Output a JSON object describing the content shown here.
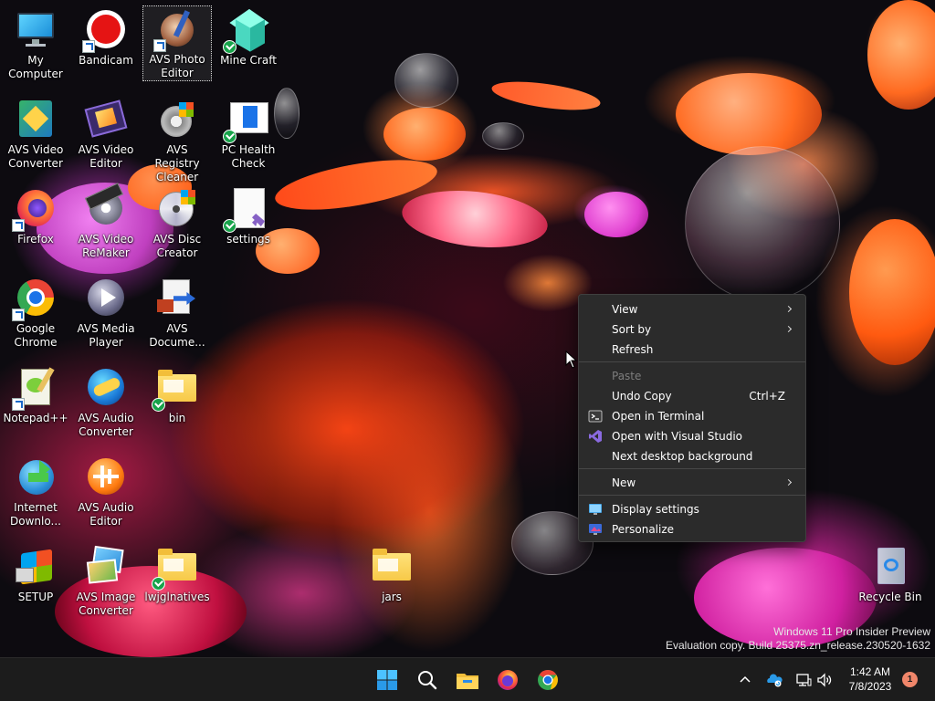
{
  "desktop": {
    "icons": [
      {
        "label": "My Computer"
      },
      {
        "label": "Bandicam"
      },
      {
        "label": "AVS Photo Editor"
      },
      {
        "label": "Mine Craft"
      },
      {
        "label": "AVS Video Converter"
      },
      {
        "label": "AVS Video Editor"
      },
      {
        "label": "AVS Registry Cleaner"
      },
      {
        "label": "PC Health Check"
      },
      {
        "label": "Firefox"
      },
      {
        "label": "AVS Video ReMaker"
      },
      {
        "label": "AVS Disc Creator"
      },
      {
        "label": "settings"
      },
      {
        "label": "Google Chrome"
      },
      {
        "label": "AVS Media Player"
      },
      {
        "label": "AVS Docume..."
      },
      {
        "label": "Notepad++"
      },
      {
        "label": "AVS Audio Converter"
      },
      {
        "label": "bin"
      },
      {
        "label": "Internet Downlo..."
      },
      {
        "label": "AVS Audio Editor"
      },
      {
        "label": "SETUP"
      },
      {
        "label": "AVS Image Converter"
      },
      {
        "label": "lwjglnatives"
      },
      {
        "label": "jars"
      },
      {
        "label": "Recycle Bin"
      }
    ]
  },
  "context_menu": {
    "items": [
      {
        "label": "View",
        "submenu": true
      },
      {
        "label": "Sort by",
        "submenu": true
      },
      {
        "label": "Refresh"
      },
      {
        "label": "Paste",
        "disabled": true
      },
      {
        "label": "Undo Copy",
        "shortcut": "Ctrl+Z"
      },
      {
        "label": "Open in Terminal",
        "icon": "terminal-icon"
      },
      {
        "label": "Open with Visual Studio",
        "icon": "visual-studio-icon"
      },
      {
        "label": "Next desktop background"
      },
      {
        "label": "New",
        "submenu": true
      },
      {
        "label": "Display settings",
        "icon": "display-icon"
      },
      {
        "label": "Personalize",
        "icon": "personalize-icon"
      }
    ]
  },
  "watermark": {
    "line1": "Windows 11 Pro Insider Preview",
    "line2": "Evaluation copy. Build 25375.zn_release.230520-1632"
  },
  "taskbar": {
    "apps": [
      "start-icon",
      "search-icon",
      "file-explorer-icon",
      "firefox-icon",
      "chrome-icon"
    ],
    "clock": {
      "time": "1:42 AM",
      "date": "7/8/2023"
    },
    "notification_count": "1"
  }
}
